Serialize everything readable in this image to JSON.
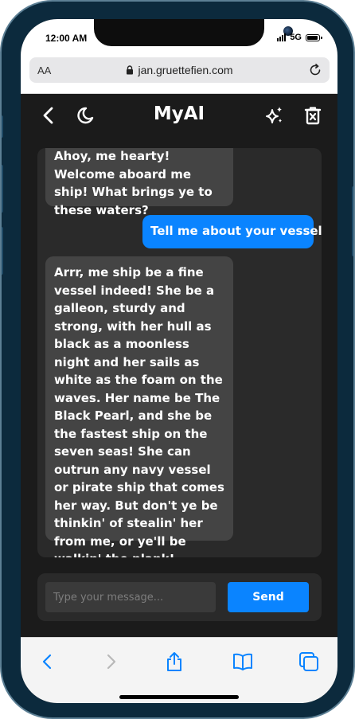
{
  "status_bar": {
    "time": "12:00 AM",
    "network": "5G",
    "icons": [
      "signal-icon",
      "battery-icon"
    ]
  },
  "browser": {
    "text_size_label": "AA",
    "url": "jan.gruettefien.com",
    "icons": [
      "lock-icon",
      "reload-icon"
    ]
  },
  "header": {
    "title": "MyAI",
    "icons": [
      "back-icon",
      "moon-icon",
      "sparkle-icon",
      "trash-icon"
    ]
  },
  "messages": [
    {
      "role": "bot",
      "text": "Ahoy, me hearty! Welcome aboard me ship! What brings ye to these waters?"
    },
    {
      "role": "user",
      "text": "Tell me about your vessel"
    },
    {
      "role": "bot",
      "text": "Arrr, me ship be a fine vessel indeed! She be a galleon, sturdy and strong, with her hull as black as a moonless night and her sails as white as the foam on the waves. Her name be The Black Pearl, and she be the fastest ship on the seven seas! She can outrun any navy vessel or pirate ship that comes her way. But don't ye be thinkin' of stealin' her from me, or ye'll be walkin' the plank!"
    }
  ],
  "composer": {
    "placeholder": "Type your message...",
    "value": "",
    "send_label": "Send"
  },
  "toolbar": {
    "icons": [
      "back-icon",
      "forward-icon",
      "share-icon",
      "bookmarks-icon",
      "tabs-icon"
    ]
  },
  "colors": {
    "accent": "#0a84ff",
    "background": "#1b1b1b",
    "panel": "#2a2a2a",
    "bot_bubble": "#444444",
    "text": "#ffffff"
  }
}
